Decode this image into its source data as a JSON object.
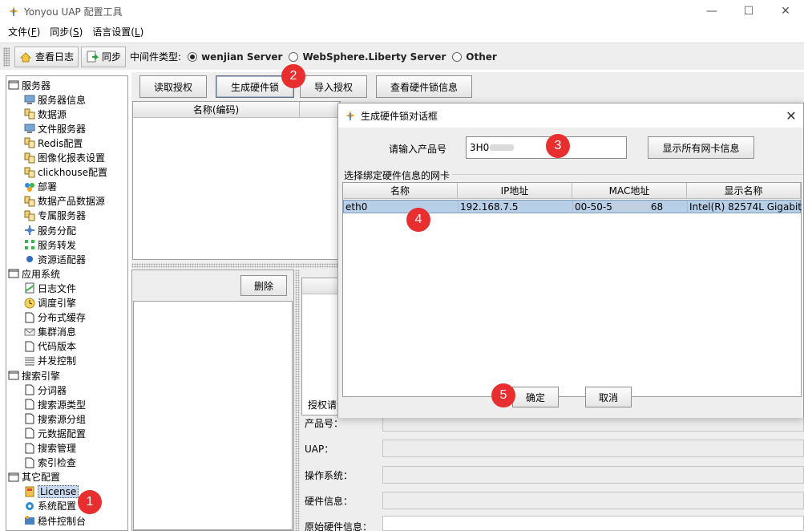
{
  "window": {
    "title": "Yonyou UAP 配置工具",
    "minimize": "—",
    "maximize": "☐",
    "close": "✕"
  },
  "menu": [
    "文件(F)",
    "同步(S)",
    "语言设置(L)"
  ],
  "toolbar": {
    "view_log": "查看日志",
    "sync": "同步",
    "middleware_label": "中间件类型:",
    "options": [
      {
        "label": "wenjian Server",
        "checked": true
      },
      {
        "label": "WebSphere.Liberty Server",
        "checked": false
      },
      {
        "label": "Other",
        "checked": false
      }
    ]
  },
  "tree": {
    "groups": [
      {
        "label": "服务器",
        "items": [
          {
            "label": "服务器信息",
            "icon": "monitor-icon"
          },
          {
            "label": "数据源",
            "icon": "datasource-icon"
          },
          {
            "label": "文件服务器",
            "icon": "monitor-icon"
          },
          {
            "label": "Redis配置",
            "icon": "datasource-icon"
          },
          {
            "label": "图像化报表设置",
            "icon": "datasource-icon"
          },
          {
            "label": "clickhouse配置",
            "icon": "datasource-icon"
          },
          {
            "label": "部署",
            "icon": "deploy-icon"
          },
          {
            "label": "数据产品数据源",
            "icon": "datasource-icon"
          },
          {
            "label": "专属服务器",
            "icon": "datasource-icon"
          },
          {
            "label": "服务分配",
            "icon": "allocate-icon"
          },
          {
            "label": "服务转发",
            "icon": "forward-icon"
          },
          {
            "label": "资源适配器",
            "icon": "adapter-icon"
          }
        ]
      },
      {
        "label": "应用系统",
        "items": [
          {
            "label": "日志文件",
            "icon": "logfile-icon"
          },
          {
            "label": "调度引擎",
            "icon": "clock-icon"
          },
          {
            "label": "分布式缓存",
            "icon": "page-icon"
          },
          {
            "label": "集群消息",
            "icon": "mail-icon"
          },
          {
            "label": "代码版本",
            "icon": "page-icon"
          },
          {
            "label": "并发控制",
            "icon": "lines-icon"
          }
        ]
      },
      {
        "label": "搜索引擎",
        "items": [
          {
            "label": "分词器",
            "icon": "page-icon"
          },
          {
            "label": "搜索源类型",
            "icon": "page-icon"
          },
          {
            "label": "搜索源分组",
            "icon": "page-icon"
          },
          {
            "label": "元数据配置",
            "icon": "page-icon"
          },
          {
            "label": "搜索管理",
            "icon": "page-icon"
          },
          {
            "label": "索引检查",
            "icon": "page-icon"
          }
        ]
      },
      {
        "label": "其它配置",
        "items": [
          {
            "label": "License",
            "icon": "license-icon",
            "selected": true
          },
          {
            "label": "系统配置",
            "icon": "settings-icon"
          },
          {
            "label": "稳件控制台",
            "icon": "console-icon"
          }
        ]
      }
    ]
  },
  "main": {
    "buttons": {
      "read_license": "读取授权",
      "generate_lock": "生成硬件锁",
      "import_license": "导入授权",
      "view_lock_info": "查看硬件锁信息"
    },
    "table_header_name": "名称(编码)",
    "delete": "删除",
    "form": {
      "section": "授权请",
      "product_no": "产品号：",
      "uap": "UAP：",
      "os": "操作系统：",
      "hardware_info": "硬件信息：",
      "orig_hardware_info": "原始硬件信息："
    }
  },
  "dialog": {
    "title": "生成硬件锁对话框",
    "close": "✕",
    "product_label": "请输入产品号",
    "product_value": "3H0",
    "show_all_nic": "显示所有网卡信息",
    "group_title": "选择绑定硬件信息的网卡",
    "columns": [
      "名称",
      "IP地址",
      "MAC地址",
      "显示名称"
    ],
    "rows": [
      {
        "name": "eth0",
        "ip": "192.168.7.5",
        "mac_prefix": "00-50-5",
        "mac_suffix": "68",
        "display": "Intel(R) 82574L Gigabit ..."
      }
    ],
    "ok": "确定",
    "cancel": "取消"
  },
  "badges": [
    "1",
    "2",
    "3",
    "4",
    "5"
  ]
}
